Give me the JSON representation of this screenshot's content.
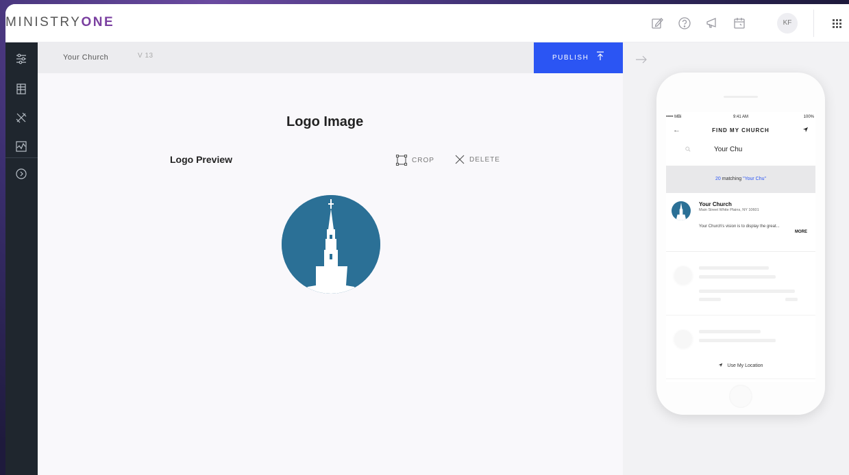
{
  "brand": {
    "prefix": "MINISTRY",
    "suffix": "ONE",
    "accent": "#7a3fa0"
  },
  "header": {
    "icons": [
      "edit-icon",
      "help-icon",
      "announcement-icon",
      "calendar-icon"
    ],
    "avatar_initials": "KF",
    "apps_icon": "grid-icon"
  },
  "sidebar": {
    "items": [
      "sliders-icon",
      "layers-icon",
      "tools-icon",
      "analytics-icon",
      "arrow-circle-icon"
    ]
  },
  "subbar": {
    "church_name": "Your Church",
    "version": "V 13",
    "publish_label": "PUBLISH"
  },
  "main": {
    "title": "Logo Image",
    "section_label": "Logo Preview",
    "crop_label": "CROP",
    "delete_label": "DELETE",
    "logo_color": "#2b7096"
  },
  "phone": {
    "status_left": "••••• MBi",
    "status_time": "9:41 AM",
    "status_battery": "100%",
    "nav_title": "FIND MY CHURCH",
    "search_value": "Your Chu",
    "match_count": "20",
    "match_text": " matching ",
    "match_query": "\"Your Chu\"",
    "result": {
      "name": "Your Church",
      "address": "Main Street White Plains, NY 10601",
      "description": "Your Church's vision is to display the great...",
      "more": "MORE"
    },
    "location_label": "Use My Location"
  },
  "colors": {
    "publish": "#2b55f3",
    "sidebar": "#1f262e"
  }
}
